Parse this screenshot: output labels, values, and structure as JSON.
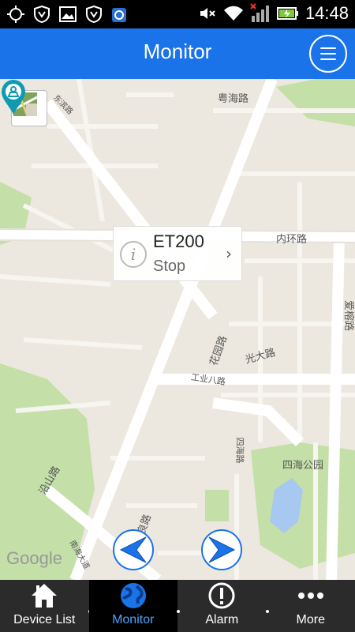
{
  "status_bar": {
    "time": "14:48"
  },
  "header": {
    "title": "Monitor"
  },
  "map": {
    "road_labels": {
      "yuehai": "粤海路",
      "neihuan": "内环路",
      "huayuan": "花园路",
      "guangda": "光大路",
      "gongye8": "工业八路",
      "sihai_road": "四海路",
      "sihai_park": "四海公园",
      "yanshan": "沿山路",
      "nanhai": "南海大道",
      "dongbin": "东滨路",
      "aiyu": "爱榕路",
      "dengliang": "登良路"
    },
    "attribution": "Google"
  },
  "device_card": {
    "name": "ET200",
    "status": "Stop"
  },
  "tabs": [
    {
      "label": "Device List",
      "icon": "home-icon"
    },
    {
      "label": "Monitor",
      "icon": "globe-icon"
    },
    {
      "label": "Alarm",
      "icon": "exclamation-icon"
    },
    {
      "label": "More",
      "icon": "more-dots-icon"
    }
  ],
  "colors": {
    "accent": "#1a73e8",
    "marker": "#0f9ab3",
    "park": "#c4dfa8",
    "water": "#a7c8f0"
  }
}
